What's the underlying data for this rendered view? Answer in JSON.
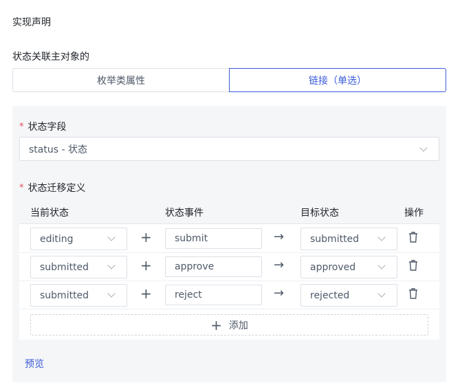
{
  "impl_title": "实现声明",
  "assoc_label": "状态关联主对象的",
  "segments": {
    "enum": "枚举类属性",
    "link": "链接（单选）"
  },
  "status_field": {
    "label": "状态字段",
    "required": "*",
    "value": "status - 状态"
  },
  "transitions": {
    "label": "状态迁移定义",
    "required": "*",
    "headers": {
      "current": "当前状态",
      "event": "状态事件",
      "target": "目标状态",
      "action": "操作"
    },
    "rows": [
      {
        "current": "editing",
        "event": "submit",
        "target": "submitted"
      },
      {
        "current": "submitted",
        "event": "approve",
        "target": "approved"
      },
      {
        "current": "submitted",
        "event": "reject",
        "target": "rejected"
      }
    ],
    "plus_symbol": "+",
    "arrow_symbol": "→",
    "add_label": "添加"
  },
  "preview_label": "预览"
}
